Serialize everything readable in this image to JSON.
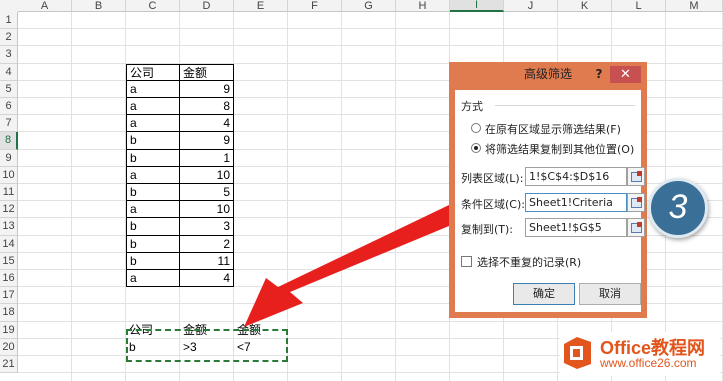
{
  "columns": [
    "A",
    "B",
    "C",
    "D",
    "E",
    "F",
    "G",
    "H",
    "I",
    "J",
    "K",
    "L",
    "M"
  ],
  "selected_column": "I",
  "rows": [
    "1",
    "2",
    "3",
    "4",
    "5",
    "6",
    "7",
    "8",
    "9",
    "10",
    "11",
    "12",
    "13",
    "14",
    "15",
    "16",
    "17",
    "18",
    "19",
    "20",
    "21"
  ],
  "selected_row": "8",
  "table": {
    "headers": [
      "公司",
      "金额"
    ],
    "records": [
      [
        "a",
        "9"
      ],
      [
        "a",
        "8"
      ],
      [
        "a",
        "4"
      ],
      [
        "b",
        "9"
      ],
      [
        "b",
        "1"
      ],
      [
        "a",
        "10"
      ],
      [
        "b",
        "5"
      ],
      [
        "a",
        "10"
      ],
      [
        "b",
        "3"
      ],
      [
        "b",
        "2"
      ],
      [
        "b",
        "11"
      ],
      [
        "a",
        "4"
      ]
    ]
  },
  "criteria": {
    "headers": [
      "公司",
      "金额",
      "金额"
    ],
    "values": [
      "b",
      ">3",
      "<7"
    ]
  },
  "dialog": {
    "title": "高级筛选",
    "help": "?",
    "close": "✕",
    "method_label": "方式",
    "option_in_place": "在原有区域显示筛选结果(F)",
    "option_copy": "将筛选结果复制到其他位置(O)",
    "list_range_label": "列表区域(L):",
    "list_range_value": "1!$C$4:$D$16",
    "criteria_range_label": "条件区域(C):",
    "criteria_range_value": "Sheet1!Criteria",
    "copy_to_label": "复制到(T):",
    "copy_to_value": "Sheet1!$G$5",
    "unique_label": "选择不重复的记录(R)",
    "ok": "确定",
    "cancel": "取消"
  },
  "step_badge": "3",
  "watermark": {
    "title": "Office教程网",
    "url": "www.office26.com"
  },
  "colors": {
    "dialog_frame": "#e07a4f",
    "arrow": "#e8201d",
    "badge": "#3a6f97",
    "selection": "#217346"
  }
}
